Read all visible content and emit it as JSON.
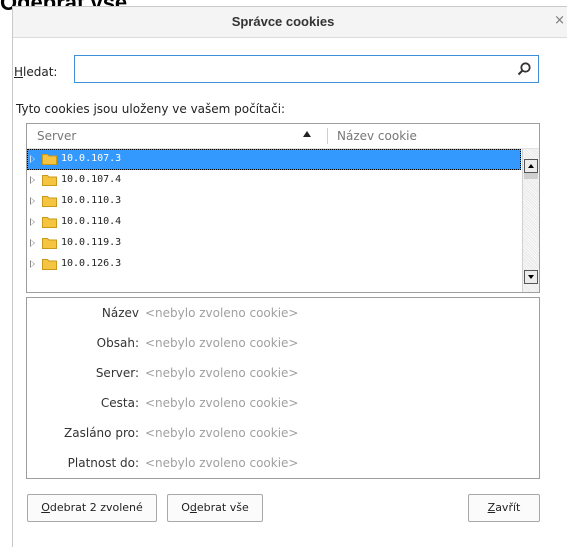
{
  "background": {
    "title": "Odebrat vše"
  },
  "window": {
    "title": "Správce cookies",
    "close_glyph": "×"
  },
  "search": {
    "label_accel": "H",
    "label_rest": "ledat:",
    "value": "",
    "placeholder": "",
    "icon": "search-icon"
  },
  "list": {
    "stored_label": "Tyto cookies jsou uloženy ve vašem počítači:",
    "columns": {
      "server": "Server",
      "name": "Název cookie"
    },
    "sort": "ascending",
    "rows": [
      {
        "label": "10.0.107.3",
        "selected": true
      },
      {
        "label": "10.0.107.4",
        "selected": false
      },
      {
        "label": "10.0.110.3",
        "selected": false
      },
      {
        "label": "10.0.110.4",
        "selected": false
      },
      {
        "label": "10.0.119.3",
        "selected": false
      },
      {
        "label": "10.0.126.3",
        "selected": false
      }
    ]
  },
  "details": [
    {
      "key": "Název",
      "value": "<nebylo zvoleno cookie>"
    },
    {
      "key": "Obsah:",
      "value": "<nebylo zvoleno cookie>"
    },
    {
      "key": "Server:",
      "value": "<nebylo zvoleno cookie>"
    },
    {
      "key": "Cesta:",
      "value": "<nebylo zvoleno cookie>"
    },
    {
      "key": "Zasláno pro:",
      "value": "<nebylo zvoleno cookie>"
    },
    {
      "key": "Platnost do:",
      "value": "<nebylo zvoleno cookie>"
    }
  ],
  "buttons": {
    "remove_selected": {
      "accel": "O",
      "rest": "debrat 2 zvolené"
    },
    "remove_all": {
      "pre": "O",
      "accel": "d",
      "rest": "ebrat vše"
    },
    "close": {
      "accel": "Z",
      "rest": "avřít"
    }
  },
  "colors": {
    "selection": "#3399ff",
    "focus_border": "#3d8fd8",
    "folder": "#f5c542"
  }
}
